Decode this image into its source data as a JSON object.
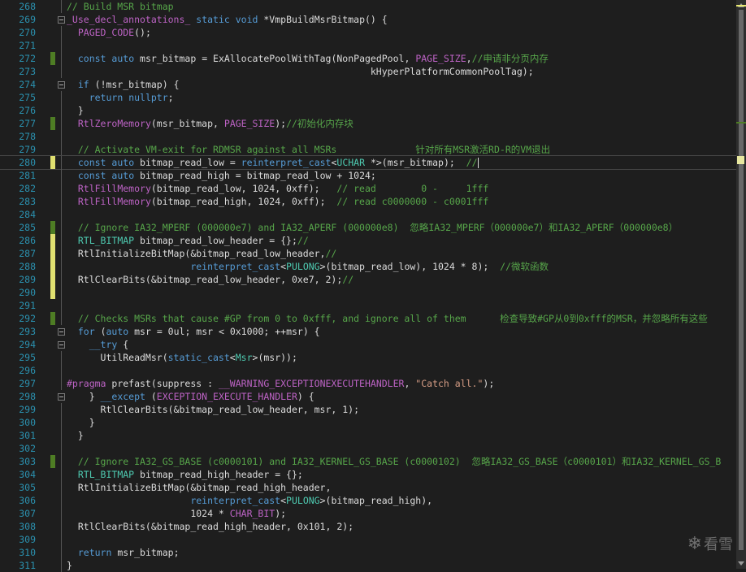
{
  "colors": {
    "background": "#1e1e1e",
    "line_number": "#2b91af",
    "keyword": "#569cd6",
    "comment": "#57a64a",
    "macro": "#bd63c5",
    "type": "#4ec9b0",
    "string": "#d69d85",
    "text": "#dcdcdc",
    "change_saved": "#4e7d24",
    "change_unsaved": "#e0e070"
  },
  "watermark": {
    "icon": "snowflake-icon",
    "text": "看雪"
  },
  "lines": [
    {
      "n": "268",
      "chg": "",
      "fold": false,
      "guide": true,
      "segs": [
        [
          "cm",
          "// Build MSR bitmap"
        ]
      ]
    },
    {
      "n": "269",
      "chg": "",
      "fold": true,
      "guide": false,
      "segs": [
        [
          "mac",
          "_Use_decl_annotations_"
        ],
        [
          "t",
          " "
        ],
        [
          "kw",
          "static"
        ],
        [
          "t",
          " "
        ],
        [
          "kw",
          "void"
        ],
        [
          "t",
          " *VmpBuildMsrBitmap() {"
        ]
      ]
    },
    {
      "n": "270",
      "chg": "",
      "fold": false,
      "guide": true,
      "segs": [
        [
          "t",
          "  "
        ],
        [
          "mac",
          "PAGED_CODE"
        ],
        [
          "t",
          "();"
        ]
      ]
    },
    {
      "n": "271",
      "chg": "",
      "fold": false,
      "guide": true,
      "segs": []
    },
    {
      "n": "272",
      "chg": "saved",
      "fold": false,
      "guide": true,
      "segs": [
        [
          "t",
          "  "
        ],
        [
          "kw",
          "const"
        ],
        [
          "t",
          " "
        ],
        [
          "kw",
          "auto"
        ],
        [
          "t",
          " msr_bitmap = ExAllocatePoolWithTag(NonPagedPool, "
        ],
        [
          "mac",
          "PAGE_SIZE"
        ],
        [
          "t",
          ","
        ],
        [
          "cm",
          "//申请非分页内存"
        ]
      ]
    },
    {
      "n": "273",
      "chg": "",
      "fold": false,
      "guide": true,
      "segs": [
        [
          "t",
          "                                                      kHyperPlatformCommonPoolTag);"
        ]
      ]
    },
    {
      "n": "274",
      "chg": "",
      "fold": true,
      "guide": false,
      "segs": [
        [
          "t",
          "  "
        ],
        [
          "kw",
          "if"
        ],
        [
          "t",
          " (!msr_bitmap) {"
        ]
      ]
    },
    {
      "n": "275",
      "chg": "",
      "fold": false,
      "guide": true,
      "segs": [
        [
          "t",
          "    "
        ],
        [
          "kw",
          "return"
        ],
        [
          "t",
          " "
        ],
        [
          "kw",
          "nullptr"
        ],
        [
          "t",
          ";"
        ]
      ]
    },
    {
      "n": "276",
      "chg": "",
      "fold": false,
      "guide": true,
      "segs": [
        [
          "t",
          "  }"
        ]
      ]
    },
    {
      "n": "277",
      "chg": "saved",
      "fold": false,
      "guide": true,
      "segs": [
        [
          "t",
          "  "
        ],
        [
          "mac",
          "RtlZeroMemory"
        ],
        [
          "t",
          "(msr_bitmap, "
        ],
        [
          "mac",
          "PAGE_SIZE"
        ],
        [
          "t",
          ");"
        ],
        [
          "cm",
          "//初始化内存块"
        ]
      ]
    },
    {
      "n": "278",
      "chg": "",
      "fold": false,
      "guide": true,
      "segs": []
    },
    {
      "n": "279",
      "chg": "",
      "fold": false,
      "guide": true,
      "segs": [
        [
          "t",
          "  "
        ],
        [
          "cm",
          "// Activate VM-exit for RDMSR against all MSRs              针对所有MSR激活RD-R的VM退出"
        ]
      ]
    },
    {
      "n": "280",
      "chg": "unsaved",
      "fold": false,
      "guide": true,
      "cur": true,
      "segs": [
        [
          "t",
          "  "
        ],
        [
          "kw",
          "const"
        ],
        [
          "t",
          " "
        ],
        [
          "kw",
          "auto"
        ],
        [
          "t",
          " bitmap_read_low = "
        ],
        [
          "kw",
          "reinterpret_cast"
        ],
        [
          "t",
          "<"
        ],
        [
          "ty",
          "UCHAR"
        ],
        [
          "t",
          " *>(msr_bitmap);  "
        ],
        [
          "cm",
          "//"
        ]
      ]
    },
    {
      "n": "281",
      "chg": "",
      "fold": false,
      "guide": true,
      "segs": [
        [
          "t",
          "  "
        ],
        [
          "kw",
          "const"
        ],
        [
          "t",
          " "
        ],
        [
          "kw",
          "auto"
        ],
        [
          "t",
          " bitmap_read_high = bitmap_read_low + 1024;"
        ]
      ]
    },
    {
      "n": "282",
      "chg": "",
      "fold": false,
      "guide": true,
      "segs": [
        [
          "t",
          "  "
        ],
        [
          "mac",
          "RtlFillMemory"
        ],
        [
          "t",
          "(bitmap_read_low, 1024, 0xff);   "
        ],
        [
          "cm",
          "// read        0 -     1fff"
        ]
      ]
    },
    {
      "n": "283",
      "chg": "",
      "fold": false,
      "guide": true,
      "segs": [
        [
          "t",
          "  "
        ],
        [
          "mac",
          "RtlFillMemory"
        ],
        [
          "t",
          "(bitmap_read_high, 1024, 0xff);  "
        ],
        [
          "cm",
          "// read c0000000 - c0001fff"
        ]
      ]
    },
    {
      "n": "284",
      "chg": "",
      "fold": false,
      "guide": true,
      "segs": []
    },
    {
      "n": "285",
      "chg": "saved",
      "fold": false,
      "guide": true,
      "segs": [
        [
          "t",
          "  "
        ],
        [
          "cm",
          "// Ignore IA32_MPERF (000000e7) and IA32_APERF (000000e8)  忽略IA32_MPERF（000000e7）和IA32_APERF（000000e8）"
        ]
      ]
    },
    {
      "n": "286",
      "chg": "unsaved",
      "fold": false,
      "guide": true,
      "segs": [
        [
          "t",
          "  "
        ],
        [
          "ty",
          "RTL_BITMAP"
        ],
        [
          "t",
          " bitmap_read_low_header = {};"
        ],
        [
          "cm",
          "//"
        ]
      ]
    },
    {
      "n": "287",
      "chg": "unsaved",
      "fold": false,
      "guide": true,
      "segs": [
        [
          "t",
          "  RtlInitializeBitMap(&bitmap_read_low_header,"
        ],
        [
          "cm",
          "//"
        ]
      ]
    },
    {
      "n": "288",
      "chg": "unsaved",
      "fold": false,
      "guide": true,
      "segs": [
        [
          "t",
          "                      "
        ],
        [
          "kw",
          "reinterpret_cast"
        ],
        [
          "t",
          "<"
        ],
        [
          "ty",
          "PULONG"
        ],
        [
          "t",
          ">(bitmap_read_low), 1024 * 8);  "
        ],
        [
          "cm",
          "//微软函数"
        ]
      ]
    },
    {
      "n": "289",
      "chg": "unsaved",
      "fold": false,
      "guide": true,
      "segs": [
        [
          "t",
          "  RtlClearBits(&bitmap_read_low_header, 0xe7, 2);"
        ],
        [
          "cm",
          "//"
        ]
      ]
    },
    {
      "n": "290",
      "chg": "unsaved",
      "fold": false,
      "guide": true,
      "segs": []
    },
    {
      "n": "291",
      "chg": "",
      "fold": false,
      "guide": true,
      "segs": []
    },
    {
      "n": "292",
      "chg": "saved",
      "fold": false,
      "guide": true,
      "segs": [
        [
          "t",
          "  "
        ],
        [
          "cm",
          "// Checks MSRs that cause #GP from 0 to 0xfff, and ignore all of them      检查导致#GP从0到0xfff的MSR，并忽略所有这些"
        ]
      ]
    },
    {
      "n": "293",
      "chg": "",
      "fold": true,
      "guide": false,
      "segs": [
        [
          "t",
          "  "
        ],
        [
          "kw",
          "for"
        ],
        [
          "t",
          " ("
        ],
        [
          "kw",
          "auto"
        ],
        [
          "t",
          " msr = 0ul; msr < 0x1000; ++msr) {"
        ]
      ]
    },
    {
      "n": "294",
      "chg": "",
      "fold": true,
      "guide": false,
      "segs": [
        [
          "t",
          "    "
        ],
        [
          "kw",
          "__try"
        ],
        [
          "t",
          " {"
        ]
      ]
    },
    {
      "n": "295",
      "chg": "",
      "fold": false,
      "guide": true,
      "segs": [
        [
          "t",
          "      UtilReadMsr("
        ],
        [
          "kw",
          "static_cast"
        ],
        [
          "t",
          "<"
        ],
        [
          "ty",
          "Msr"
        ],
        [
          "t",
          ">(msr));"
        ]
      ]
    },
    {
      "n": "296",
      "chg": "",
      "fold": false,
      "guide": true,
      "segs": []
    },
    {
      "n": "297",
      "chg": "",
      "fold": false,
      "guide": true,
      "segs": [
        [
          "mac",
          "#pragma"
        ],
        [
          "t",
          " prefast(suppress : "
        ],
        [
          "mac",
          "__WARNING_EXCEPTIONEXECUTEHANDLER"
        ],
        [
          "t",
          ", "
        ],
        [
          "st",
          "\"Catch all.\""
        ],
        [
          "t",
          ");"
        ]
      ]
    },
    {
      "n": "298",
      "chg": "",
      "fold": true,
      "guide": false,
      "segs": [
        [
          "t",
          "    } "
        ],
        [
          "kw",
          "__except"
        ],
        [
          "t",
          " ("
        ],
        [
          "mac",
          "EXCEPTION_EXECUTE_HANDLER"
        ],
        [
          "t",
          ") {"
        ]
      ]
    },
    {
      "n": "299",
      "chg": "",
      "fold": false,
      "guide": true,
      "segs": [
        [
          "t",
          "      RtlClearBits(&bitmap_read_low_header, msr, 1);"
        ]
      ]
    },
    {
      "n": "300",
      "chg": "",
      "fold": false,
      "guide": true,
      "segs": [
        [
          "t",
          "    }"
        ]
      ]
    },
    {
      "n": "301",
      "chg": "",
      "fold": false,
      "guide": true,
      "segs": [
        [
          "t",
          "  }"
        ]
      ]
    },
    {
      "n": "302",
      "chg": "",
      "fold": false,
      "guide": true,
      "segs": []
    },
    {
      "n": "303",
      "chg": "saved",
      "fold": false,
      "guide": true,
      "segs": [
        [
          "t",
          "  "
        ],
        [
          "cm",
          "// Ignore IA32_GS_BASE (c0000101) and IA32_KERNEL_GS_BASE (c0000102)  忽略IA32_GS_BASE（c0000101）和IA32_KERNEL_GS_B"
        ]
      ]
    },
    {
      "n": "304",
      "chg": "",
      "fold": false,
      "guide": true,
      "segs": [
        [
          "t",
          "  "
        ],
        [
          "ty",
          "RTL_BITMAP"
        ],
        [
          "t",
          " bitmap_read_high_header = {};"
        ]
      ]
    },
    {
      "n": "305",
      "chg": "",
      "fold": false,
      "guide": true,
      "segs": [
        [
          "t",
          "  RtlInitializeBitMap(&bitmap_read_high_header,"
        ]
      ]
    },
    {
      "n": "306",
      "chg": "",
      "fold": false,
      "guide": true,
      "segs": [
        [
          "t",
          "                      "
        ],
        [
          "kw",
          "reinterpret_cast"
        ],
        [
          "t",
          "<"
        ],
        [
          "ty",
          "PULONG"
        ],
        [
          "t",
          ">(bitmap_read_high),"
        ]
      ]
    },
    {
      "n": "307",
      "chg": "",
      "fold": false,
      "guide": true,
      "segs": [
        [
          "t",
          "                      1024 * "
        ],
        [
          "mac",
          "CHAR_BIT"
        ],
        [
          "t",
          ");"
        ]
      ]
    },
    {
      "n": "308",
      "chg": "",
      "fold": false,
      "guide": true,
      "segs": [
        [
          "t",
          "  RtlClearBits(&bitmap_read_high_header, 0x101, 2);"
        ]
      ]
    },
    {
      "n": "309",
      "chg": "",
      "fold": false,
      "guide": true,
      "segs": []
    },
    {
      "n": "310",
      "chg": "",
      "fold": false,
      "guide": true,
      "segs": [
        [
          "t",
          "  "
        ],
        [
          "kw",
          "return"
        ],
        [
          "t",
          " msr_bitmap;"
        ]
      ]
    },
    {
      "n": "311",
      "chg": "",
      "fold": false,
      "guide": true,
      "segs": [
        [
          "t",
          "}"
        ]
      ]
    }
  ]
}
